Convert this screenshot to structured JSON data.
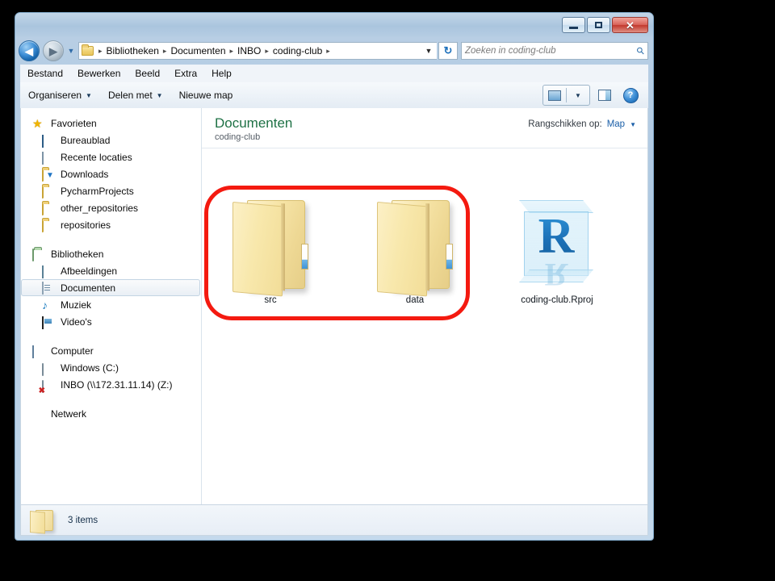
{
  "window": {
    "title": "",
    "controls": {
      "minimize": "–",
      "maximize": "□",
      "close": "✕"
    }
  },
  "navigation": {
    "back_arrow": "◀",
    "forward_arrow": "▶",
    "history_caret": "▼",
    "breadcrumb": [
      "Bibliotheken",
      "Documenten",
      "INBO",
      "coding-club"
    ],
    "breadcrumb_separator": "▸",
    "dropdown_caret": "▼",
    "refresh_glyph": "↻"
  },
  "search": {
    "placeholder": "Zoeken in coding-club",
    "value": "",
    "icon_glyph": "⚲"
  },
  "menubar": {
    "items": [
      "Bestand",
      "Bewerken",
      "Beeld",
      "Extra",
      "Help"
    ]
  },
  "toolbar": {
    "items": [
      {
        "label": "Organiseren",
        "has_caret": true
      },
      {
        "label": "Delen met",
        "has_caret": true
      },
      {
        "label": "Nieuwe map",
        "has_caret": false
      }
    ],
    "caret": "▼",
    "help_glyph": "?"
  },
  "sidebar": {
    "groups": [
      {
        "header": {
          "label": "Favorieten",
          "icon": "star-icon"
        },
        "items": [
          {
            "label": "Bureaublad",
            "icon": "desktop-icon"
          },
          {
            "label": "Recente locaties",
            "icon": "recent-locations-icon"
          },
          {
            "label": "Downloads",
            "icon": "downloads-folder-icon"
          },
          {
            "label": "PycharmProjects",
            "icon": "folder-icon"
          },
          {
            "label": "other_repositories",
            "icon": "folder-icon"
          },
          {
            "label": "repositories",
            "icon": "folder-icon"
          }
        ]
      },
      {
        "header": {
          "label": "Bibliotheken",
          "icon": "library-icon"
        },
        "items": [
          {
            "label": "Afbeeldingen",
            "icon": "pictures-icon"
          },
          {
            "label": "Documenten",
            "icon": "documents-icon",
            "selected": true
          },
          {
            "label": "Muziek",
            "icon": "music-icon"
          },
          {
            "label": "Video's",
            "icon": "video-icon"
          }
        ]
      },
      {
        "header": {
          "label": "Computer",
          "icon": "computer-icon"
        },
        "items": [
          {
            "label": "Windows (C:)",
            "icon": "hard-drive-icon"
          },
          {
            "label": "INBO (\\\\172.31.11.14) (Z:)",
            "icon": "network-drive-disconnected-icon"
          }
        ]
      },
      {
        "header": {
          "label": "Netwerk",
          "icon": "network-icon"
        },
        "items": []
      }
    ]
  },
  "content": {
    "library_title": "Documenten",
    "library_subtitle": "coding-club",
    "arrange": {
      "label": "Rangschikken op:",
      "value": "Map",
      "caret": "▼"
    },
    "items": [
      {
        "name": "src",
        "type": "folder"
      },
      {
        "name": "data",
        "type": "folder"
      },
      {
        "name": "coding-club.Rproj",
        "type": "rproject"
      }
    ],
    "rproject_letter": "R",
    "annotation": {
      "shape": "rounded-rectangle",
      "color": "#f41a10"
    }
  },
  "statusbar": {
    "item_count_text": "3 items"
  },
  "colors": {
    "library_title": "#1e7145",
    "annotation_red": "#f41a10",
    "accent_blue": "#1b5fa8",
    "frame_blue": "#aec8e2"
  }
}
